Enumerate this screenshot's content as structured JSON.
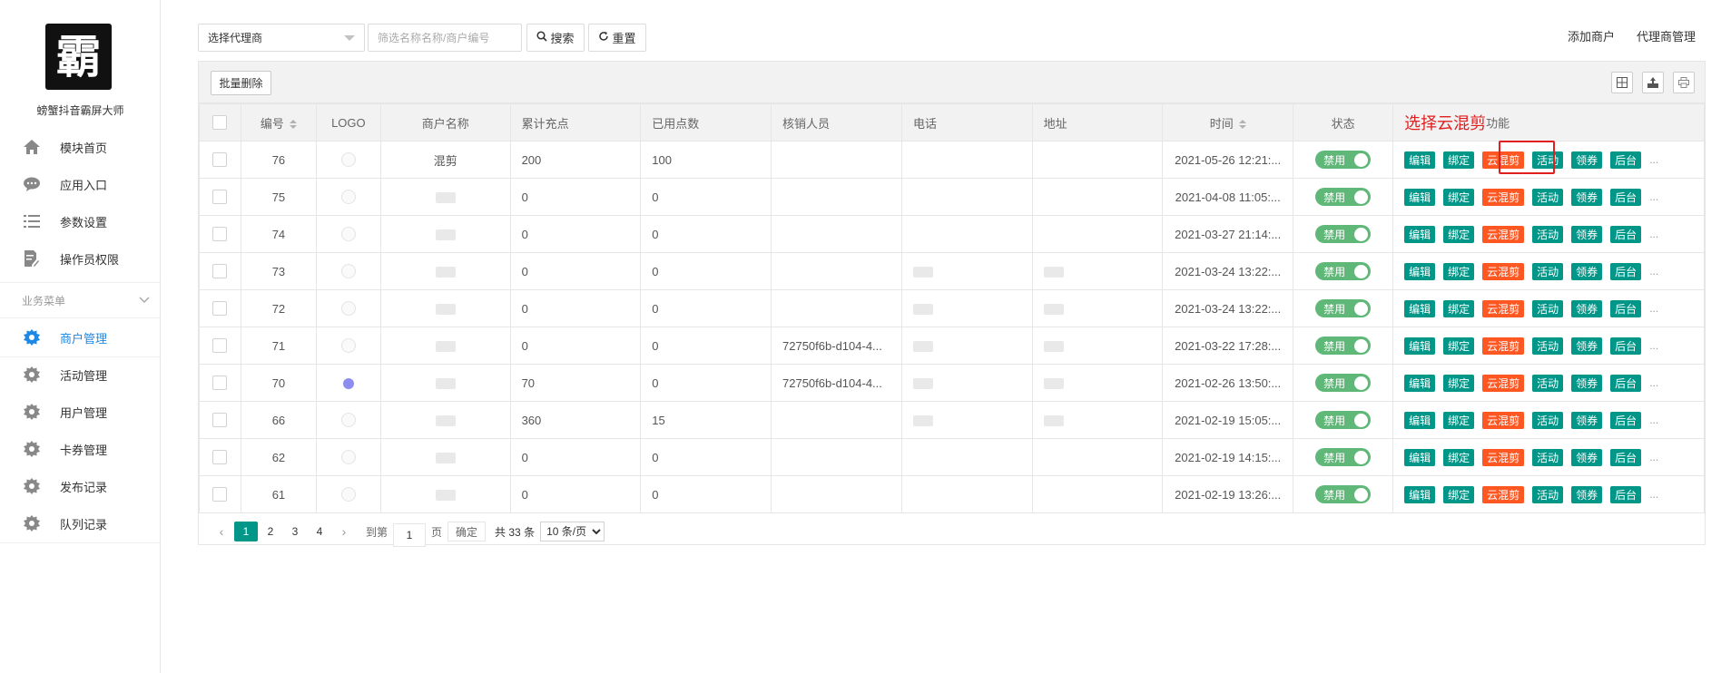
{
  "sidebar": {
    "logo_glyph": "霸",
    "app_name": "螃蟹抖音霸屏大师",
    "top_items": [
      {
        "label": "模块首页",
        "icon": "home-icon"
      },
      {
        "label": "应用入口",
        "icon": "chat-bubble-icon"
      },
      {
        "label": "参数设置",
        "icon": "list-icon"
      },
      {
        "label": "操作员权限",
        "icon": "document-edit-icon"
      }
    ],
    "section_label": "业务菜单",
    "biz_items": [
      {
        "label": "商户管理",
        "icon": "gear-icon",
        "active": true
      },
      {
        "label": "活动管理",
        "icon": "gear-icon"
      },
      {
        "label": "用户管理",
        "icon": "gear-icon"
      },
      {
        "label": "卡券管理",
        "icon": "gear-icon"
      },
      {
        "label": "发布记录",
        "icon": "gear-icon"
      },
      {
        "label": "队列记录",
        "icon": "gear-icon"
      }
    ],
    "active_color": "#1e88e5"
  },
  "toolbar": {
    "agent_select": "选择代理商",
    "search_placeholder": "筛选名称名称/商户编号",
    "search_label": "搜索",
    "reset_label": "重置",
    "add_merchant": "添加商户",
    "agent_manage": "代理商管理"
  },
  "panel": {
    "batch_delete": "批量删除",
    "icons": [
      "grid-columns-icon",
      "export-icon",
      "print-icon"
    ]
  },
  "table": {
    "headers": {
      "id": "编号",
      "logo": "LOGO",
      "name": "商户名称",
      "recharge": "累计充点",
      "used": "已用点数",
      "verifier": "核销人员",
      "phone": "电话",
      "address": "地址",
      "time": "时间",
      "status": "状态",
      "ops_suffix": "功能"
    },
    "annotation": "选择云混剪",
    "status_label": "禁用",
    "actions": [
      "编辑",
      "绑定",
      "云混剪",
      "活动",
      "领券",
      "后台"
    ],
    "more": "...",
    "rows": [
      {
        "id": "76",
        "name": "混剪",
        "recharge": "200",
        "used": "100",
        "verifier": "",
        "time": "2021-05-26 12:21:...",
        "phone_blur": false,
        "addr_blur": false
      },
      {
        "id": "75",
        "name": "",
        "recharge": "0",
        "used": "0",
        "verifier": "",
        "time": "2021-04-08 11:05:...",
        "phone_blur": false,
        "addr_blur": false
      },
      {
        "id": "74",
        "name": "",
        "recharge": "0",
        "used": "0",
        "verifier": "",
        "time": "2021-03-27 21:14:...",
        "phone_blur": false,
        "addr_blur": false
      },
      {
        "id": "73",
        "name": "",
        "recharge": "0",
        "used": "0",
        "verifier": "",
        "time": "2021-03-24 13:22:...",
        "phone_blur": true,
        "addr_blur": true
      },
      {
        "id": "72",
        "name": "",
        "recharge": "0",
        "used": "0",
        "verifier": "",
        "time": "2021-03-24 13:22:...",
        "phone_blur": true,
        "addr_blur": true
      },
      {
        "id": "71",
        "name": "",
        "recharge": "0",
        "used": "0",
        "verifier": "72750f6b-d104-4...",
        "time": "2021-03-22 17:28:...",
        "phone_blur": true,
        "addr_blur": true
      },
      {
        "id": "70",
        "name": "",
        "recharge": "70",
        "used": "0",
        "verifier": "72750f6b-d104-4...",
        "time": "2021-02-26 13:50:...",
        "phone_blur": true,
        "addr_blur": true
      },
      {
        "id": "66",
        "name": "",
        "recharge": "360",
        "used": "15",
        "verifier": "",
        "time": "2021-02-19 15:05:...",
        "phone_blur": true,
        "addr_blur": true
      },
      {
        "id": "62",
        "name": "",
        "recharge": "0",
        "used": "0",
        "verifier": "",
        "time": "2021-02-19 14:15:...",
        "phone_blur": false,
        "addr_blur": false
      },
      {
        "id": "61",
        "name": "",
        "recharge": "0",
        "used": "0",
        "verifier": "",
        "time": "2021-02-19 13:26:...",
        "phone_blur": false,
        "addr_blur": false
      }
    ]
  },
  "pagination": {
    "pages": [
      "1",
      "2",
      "3",
      "4"
    ],
    "current": "1",
    "goto_label": "到第",
    "goto_value": "1",
    "page_unit": "页",
    "confirm": "确定",
    "total": "共 33 条",
    "per_page": "10 条/页"
  },
  "colors": {
    "primary_green": "#009688",
    "cloud_orange": "#ff5722",
    "toggle_green": "#5fb878",
    "annotation_red": "#e02020"
  }
}
